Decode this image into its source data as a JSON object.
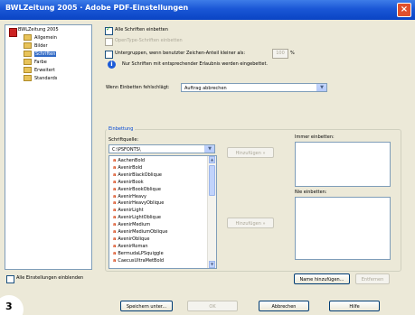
{
  "window": {
    "title": "BWLZeitung 2005 · Adobe PDF-Einstellungen",
    "close_label": "×"
  },
  "tree": {
    "root": "BWLZeitung 2005",
    "items": [
      "Allgemein",
      "Bilder",
      "Schriften",
      "Farbe",
      "Erweitert",
      "Standards"
    ],
    "selected_index": 2
  },
  "options": {
    "embed_all": "Alle Schriften einbetten",
    "embed_opentype": "OpenType-Schriften einbetten",
    "subset": "Untergruppen, wenn benutzter Zeichen-Anteil kleiner als:",
    "subset_value": "100",
    "subset_unit": "%",
    "info": "Nur Schriften mit entsprechender Erlaubnis werden eingebettet.",
    "fail_label": "Wenn Einbetten fehlschlägt:",
    "fail_value": "Auftrag abbrechen"
  },
  "embedding": {
    "group_label": "Einbettung",
    "source_label": "Schriftquelle:",
    "source_value": "C:\\PSFONTS\\",
    "fonts": [
      "AachenBold",
      "AvenirBold",
      "AvenirBlackOblique",
      "AvenirBook",
      "AvenirBookOblique",
      "AvenirHeavy",
      "AvenirHeavyOblique",
      "AvenirLight",
      "AvenirLightOblique",
      "AvenirMedium",
      "AvenirMediumOblique",
      "AvenirOblique",
      "AvenirRoman",
      "BermudaLPSquiggle",
      "CaecusUltraMetBold"
    ],
    "always_embed_label": "Immer einbetten:",
    "never_embed_label": "Nie einbetten:",
    "add_btn_1": "Hinzufügen »",
    "add_btn_2": "Hinzufügen »",
    "add_name_btn": "Name hinzufügen...",
    "remove_btn": "Entfernen"
  },
  "footer": {
    "show_all": "Alle Einstellungen einblenden",
    "save_as": "Speichern unter...",
    "ok": "OK",
    "cancel": "Abbrechen",
    "help": "Hilfe"
  },
  "page_marker": "3"
}
